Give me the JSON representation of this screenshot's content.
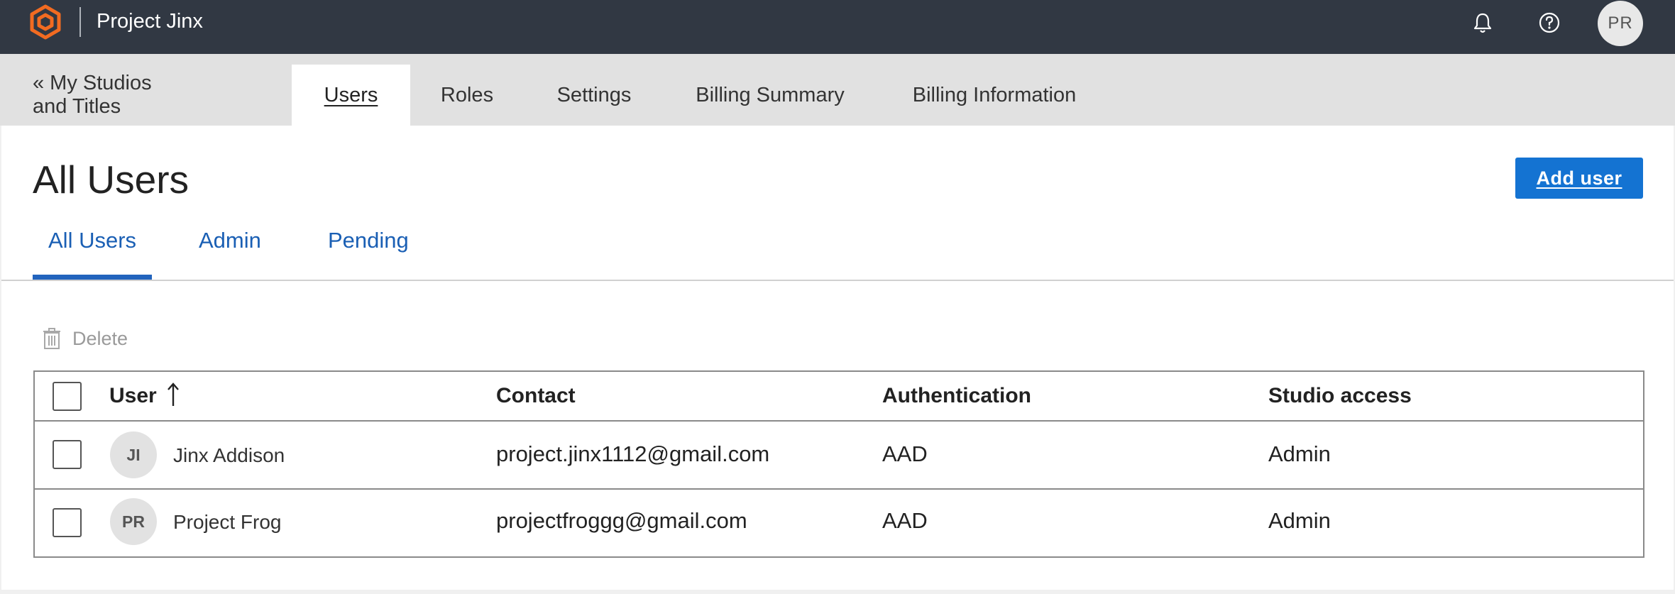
{
  "header": {
    "app_title": "Project Jinx",
    "user_initials": "PR",
    "icons": [
      "hexagon-logo-icon",
      "bell-icon",
      "help-icon"
    ],
    "brand_color": "#f26b21"
  },
  "nav": {
    "tabs": [
      {
        "label": "« My Studios and Titles",
        "active": false
      },
      {
        "label": "Users",
        "active": true
      },
      {
        "label": "Roles",
        "active": false
      },
      {
        "label": "Settings",
        "active": false
      },
      {
        "label": "Billing Summary",
        "active": false
      },
      {
        "label": "Billing Information",
        "active": false
      }
    ]
  },
  "page": {
    "title": "All Users",
    "add_user_label": "Add user",
    "accent_color": "#1473d2"
  },
  "subtabs": [
    {
      "label": "All Users",
      "active": true
    },
    {
      "label": "Admin",
      "active": false
    },
    {
      "label": "Pending",
      "active": false
    }
  ],
  "toolbar": {
    "delete_label": "Delete"
  },
  "table": {
    "columns": [
      "User",
      "Contact",
      "Authentication",
      "Studio access"
    ],
    "sort": {
      "column": "User",
      "direction": "ascending"
    },
    "rows": [
      {
        "initials": "JI",
        "name": "Jinx Addison",
        "contact": "project.jinx1112@gmail.com",
        "auth": "AAD",
        "studio_access": "Admin"
      },
      {
        "initials": "PR",
        "name": "Project Frog",
        "contact": "projectfroggg@gmail.com",
        "auth": "AAD",
        "studio_access": "Admin"
      }
    ]
  }
}
